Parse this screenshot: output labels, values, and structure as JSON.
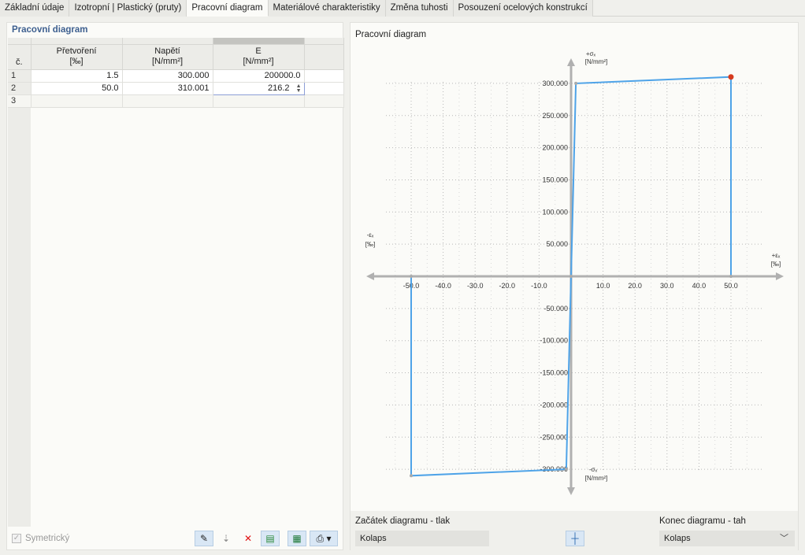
{
  "tabs": [
    "Základní údaje",
    "Izotropní | Plastický (pruty)",
    "Pracovní diagram",
    "Materiálové charakteristiky",
    "Změna tuhosti",
    "Posouzení ocelových konstrukcí"
  ],
  "table": {
    "title": "Pracovní diagram",
    "columns": [
      {
        "label": "č.",
        "unit": ""
      },
      {
        "label": "Přetvoření",
        "unit": "[‰]"
      },
      {
        "label": "Napětí",
        "unit": "[N/mm²]"
      },
      {
        "label": "E",
        "unit": "[N/mm²]"
      }
    ],
    "rows": [
      {
        "num": "1",
        "strain": "1.5",
        "stress": "300.000",
        "E": "200000.0"
      },
      {
        "num": "2",
        "strain": "50.0",
        "stress": "310.001",
        "E": "216.2"
      },
      {
        "num": "3",
        "strain": "",
        "stress": "",
        "E": ""
      }
    ]
  },
  "symmetric": {
    "label": "Symetrický",
    "checked": true
  },
  "diagram": {
    "title": "Pracovní diagram",
    "axis": {
      "x_pos": "+εₓ",
      "x_neg": "-εₓ",
      "x_unit": "[‰]",
      "y_pos": "+σₓ",
      "y_neg": "-σₓ",
      "y_unit": "[N/mm²]"
    }
  },
  "chart_data": {
    "type": "line",
    "xlabel": "εₓ [‰]",
    "ylabel": "σₓ [N/mm²]",
    "xlim": [
      -60,
      60
    ],
    "ylim": [
      -300,
      300
    ],
    "x_ticks": [
      "-50.0",
      "-40.0",
      "-30.0",
      "-20.0",
      "-10.0",
      "10.0",
      "20.0",
      "30.0",
      "40.0",
      "50.0"
    ],
    "y_ticks": [
      "300.000",
      "250.000",
      "200.000",
      "150.000",
      "100.000",
      "50.000",
      "-50.000",
      "-100.000",
      "-150.000",
      "-200.000",
      "-250.000",
      "-300.000"
    ],
    "x_tick_values": [
      -50,
      -40,
      -30,
      -20,
      -10,
      10,
      20,
      30,
      40,
      50
    ],
    "y_tick_values": [
      300,
      250,
      200,
      150,
      100,
      50,
      -50,
      -100,
      -150,
      -200,
      -250,
      -300
    ],
    "series": [
      {
        "x": [
          -50,
          -50,
          -1.5,
          0,
          1.5,
          50,
          50
        ],
        "y": [
          0,
          -310.001,
          -300,
          0,
          300,
          310.001,
          0
        ]
      }
    ],
    "highlight_point": {
      "x": 50,
      "y": 310.001
    },
    "grid": true
  },
  "bottom": {
    "start_label": "Začátek diagramu - tlak",
    "start_value": "Kolaps",
    "end_label": "Konec diagramu - tah",
    "end_value": "Kolaps"
  },
  "colors": {
    "line": "#4ea3e8",
    "point": "#d63a1e",
    "title": "#3d5f8f"
  }
}
